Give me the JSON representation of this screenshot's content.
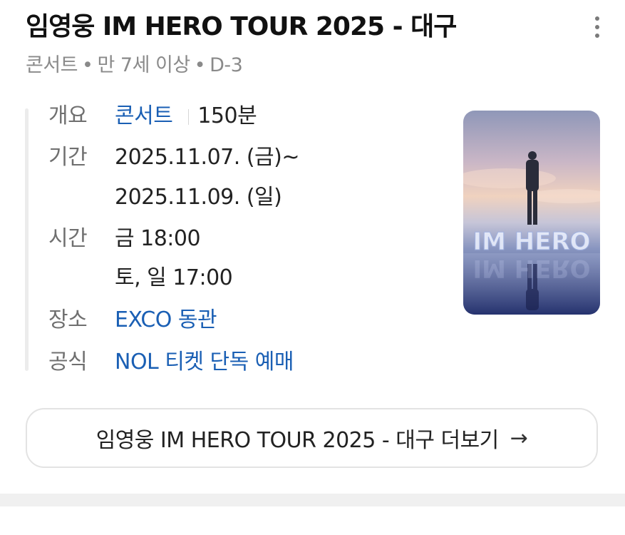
{
  "header": {
    "title": "임영웅 IM HERO TOUR 2025 - 대구",
    "subtitle_parts": [
      "콘서트",
      "만 7세 이상",
      "D-3"
    ],
    "dot": "•"
  },
  "info": {
    "overview": {
      "label": "개요",
      "genre": "콘서트",
      "duration": "150분"
    },
    "period": {
      "label": "기간",
      "start": "2025.11.07. (금)~",
      "end": "2025.11.09. (일)"
    },
    "time": {
      "label": "시간",
      "line1": "금 18:00",
      "line2": "토, 일 17:00"
    },
    "venue": {
      "label": "장소",
      "value": "EXCO 동관"
    },
    "official": {
      "label": "공식",
      "value": "NOL 티켓 단독 예매"
    }
  },
  "poster": {
    "text": "IM HERO"
  },
  "more_button": {
    "label": "임영웅 IM HERO TOUR 2025 - 대구 더보기",
    "arrow": "→"
  },
  "colors": {
    "link": "#1a5fb4",
    "label": "#6f6f6f",
    "muted": "#8a8a8a"
  },
  "icons": {
    "menu": "more-vertical-icon",
    "arrow": "arrow-right-icon"
  }
}
